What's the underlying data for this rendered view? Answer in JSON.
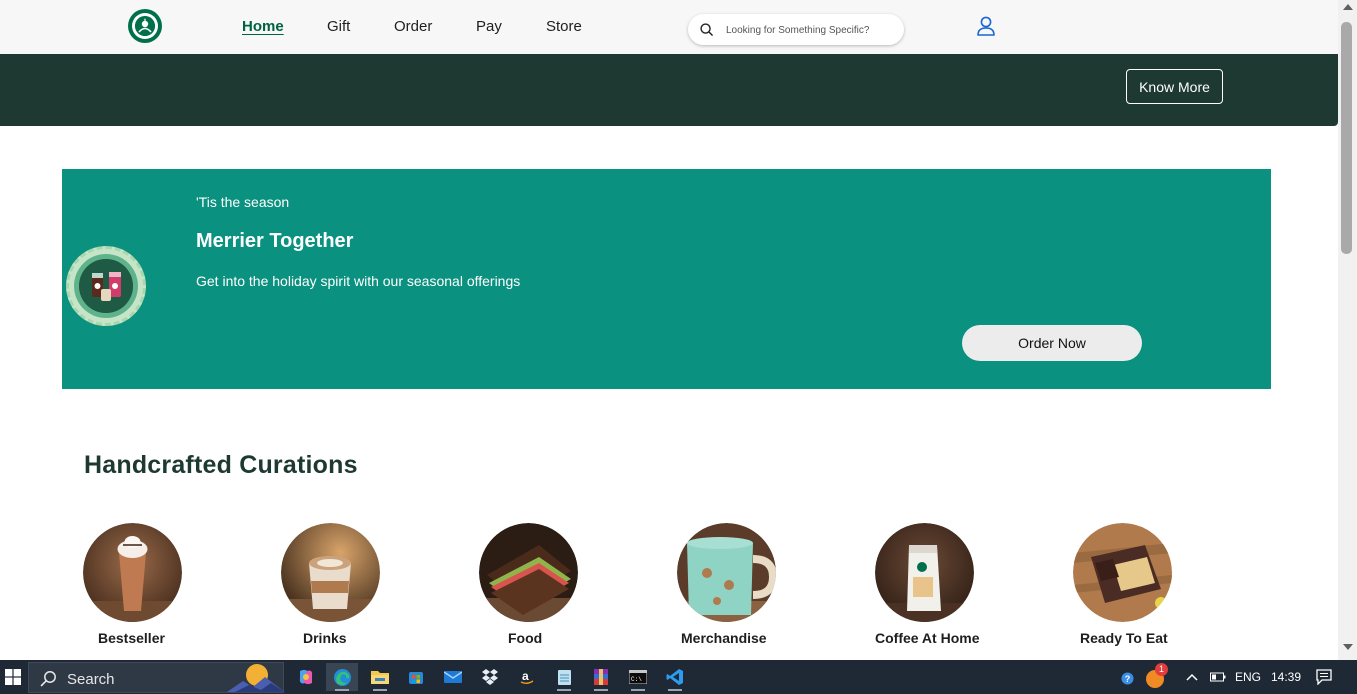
{
  "header": {
    "logo_alt": "Starbucks",
    "nav": [
      {
        "label": "Home",
        "active": true
      },
      {
        "label": "Gift",
        "active": false
      },
      {
        "label": "Order",
        "active": false
      },
      {
        "label": "Pay",
        "active": false
      },
      {
        "label": "Store",
        "active": false
      }
    ],
    "search_placeholder": "Looking for Something Specific?"
  },
  "band": {
    "know_more_label": "Know More"
  },
  "promo": {
    "eyebrow": "'Tis the season",
    "title": "Merrier Together",
    "description": "Get into the holiday spirit with our seasonal offerings",
    "cta_label": "Order Now"
  },
  "curations": {
    "title": "Handcrafted Curations",
    "items": [
      {
        "label": "Bestseller"
      },
      {
        "label": "Drinks"
      },
      {
        "label": "Food"
      },
      {
        "label": "Merchandise"
      },
      {
        "label": "Coffee At Home"
      },
      {
        "label": "Ready To Eat"
      }
    ]
  },
  "taskbar": {
    "search_label": "Search",
    "language": "ENG",
    "time": "14:39",
    "notification_count": "1"
  },
  "colors": {
    "brand_green": "#00704a",
    "dark_band": "#1e3932",
    "promo_bg": "#0a9180",
    "active_nav": "#006241"
  }
}
